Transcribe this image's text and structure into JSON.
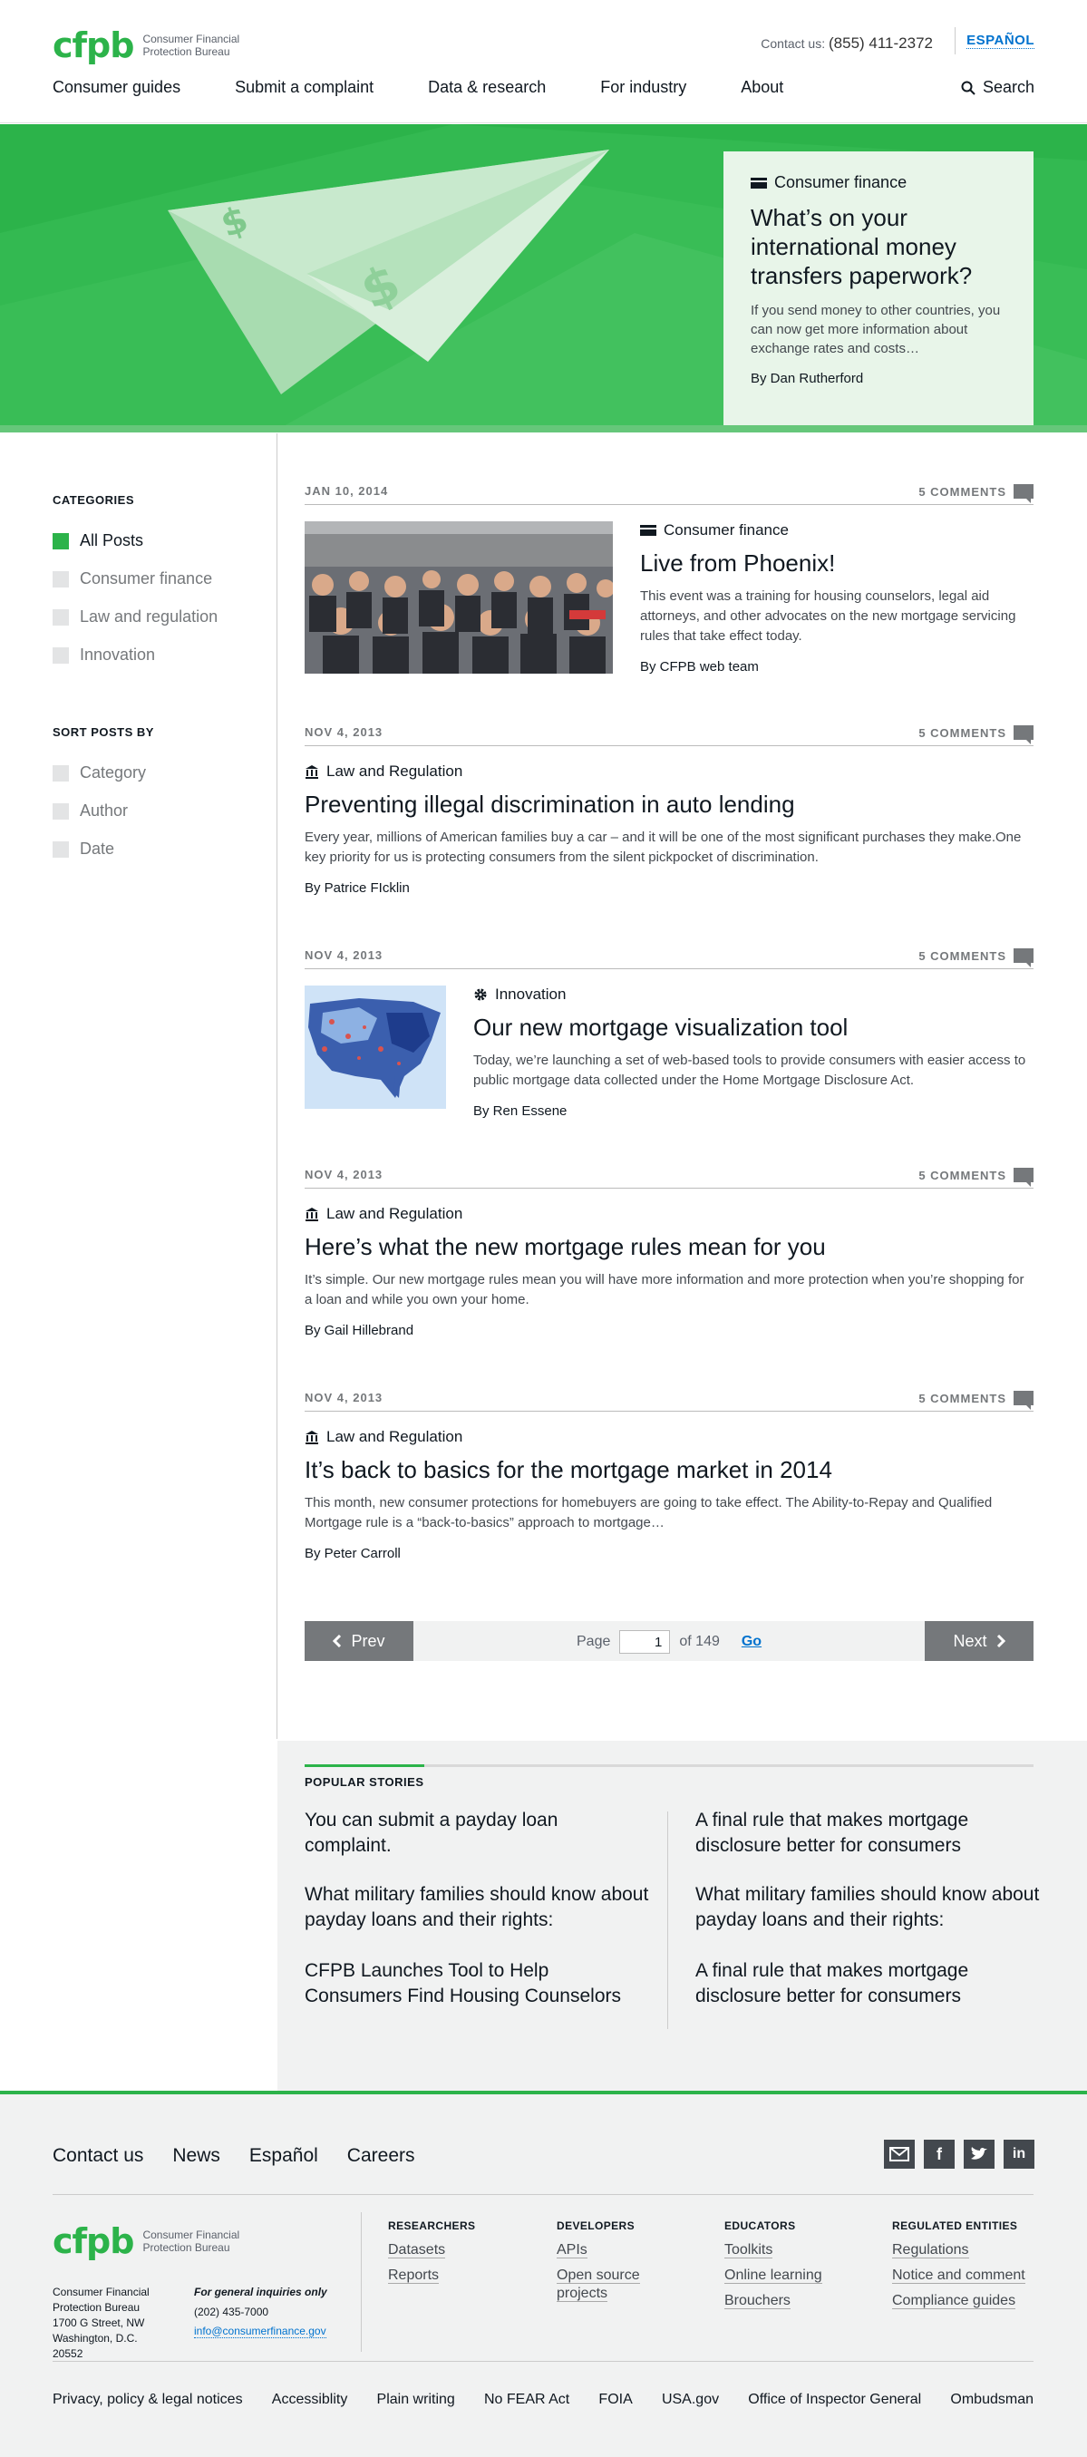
{
  "header": {
    "logo_mark": "cfpb",
    "logo_line1": "Consumer Financial",
    "logo_line2": "Protection Bureau",
    "contact_label": "Contact us:",
    "contact_phone": "(855) 411-2372",
    "language_link": "ESPAÑOL",
    "nav": [
      "Consumer guides",
      "Submit a complaint",
      "Data & research",
      "For industry",
      "About"
    ],
    "search_label": "Search"
  },
  "hero": {
    "category": "Consumer finance",
    "title": "What’s on your international money transfers paperwork?",
    "description": "If you send money to other countries, you can now get more information about exchange rates and costs…",
    "author": "By Dan Rutherford"
  },
  "sidebar": {
    "categories_heading": "CATEGORIES",
    "categories": [
      {
        "label": "All Posts",
        "checked": true
      },
      {
        "label": "Consumer finance",
        "checked": false
      },
      {
        "label": "Law and regulation",
        "checked": false
      },
      {
        "label": "Innovation",
        "checked": false
      }
    ],
    "sort_heading": "SORT POSTS BY",
    "sort": [
      {
        "label": "Category"
      },
      {
        "label": "Author"
      },
      {
        "label": "Date"
      }
    ]
  },
  "posts": [
    {
      "date": "JAN 10, 2014",
      "comments": "5 COMMENTS",
      "category": "Consumer finance",
      "category_icon": "card-icon",
      "title": "Live from Phoenix!",
      "description": "This event was a training for housing counselors, legal aid attorneys, and other advocates on the new mortgage servicing rules that take effect today.",
      "author": "By CFPB web team"
    },
    {
      "date": "NOV 4, 2013",
      "comments": "5 COMMENTS",
      "category": "Law and Regulation",
      "category_icon": "bank-icon",
      "title": "Preventing illegal discrimination in auto lending",
      "description": "Every year, millions of American families buy a car – and it will be one of the most significant purchases they make.One key priority for us is protecting consumers from the silent pickpocket of discrimination.",
      "author": "By Patrice FIcklin"
    },
    {
      "date": "NOV 4, 2013",
      "comments": "5 COMMENTS",
      "category": "Innovation",
      "category_icon": "gear-icon",
      "title": "Our new mortgage visualization tool",
      "description": "Today, we’re launching a set of web-based tools to provide consumers with easier access to public mortgage data collected under the Home Mortgage Disclosure Act.",
      "author": "By Ren Essene"
    },
    {
      "date": "NOV 4, 2013",
      "comments": "5 COMMENTS",
      "category": "Law and Regulation",
      "category_icon": "bank-icon",
      "title": "Here’s what the new mortgage rules mean for you",
      "description": "It’s simple. Our new mortgage rules mean you will have more information and more protection when you’re shopping for a loan and while you own your home.",
      "author": "By Gail Hillebrand"
    },
    {
      "date": "NOV 4, 2013",
      "comments": "5 COMMENTS",
      "category": "Law and Regulation",
      "category_icon": "bank-icon",
      "title": "It’s back to basics for the mortgage market in 2014",
      "description": "This month, new consumer protections for homebuyers are going to take effect. The Ability-to-Repay and Qualified Mortgage rule is a “back-to-basics” approach to mortgage…",
      "author": "By Peter Carroll"
    }
  ],
  "pagination": {
    "prev": "Prev",
    "next": "Next",
    "page_label": "Page",
    "page_value": "1",
    "of_label": "of 149",
    "go": "Go"
  },
  "popular": {
    "heading": "POPULAR STORIES",
    "left": [
      "You can submit a payday loan complaint.",
      "What military families should know about payday loans and their rights:",
      "CFPB Launches Tool to Help Consumers Find Housing Counselors"
    ],
    "right": [
      "A final rule that makes mortgage disclosure better for consumers",
      "What military families should know about payday loans and their rights:",
      "A final rule that makes mortgage disclosure better for consumers"
    ]
  },
  "footer": {
    "links": [
      "Contact us",
      "News",
      "Español",
      "Careers"
    ],
    "social": [
      "email-icon",
      "facebook-icon",
      "twitter-icon",
      "linkedin-icon"
    ],
    "address": [
      "Consumer Financial",
      "Protection Bureau",
      "1700 G Street, NW",
      "Washington, D.C. 20552"
    ],
    "inquiries_label": "For general inquiries only",
    "inquiries_phone": "(202) 435-7000",
    "inquiries_email": "info@consumerfinance.gov",
    "columns": [
      {
        "heading": "RESEARCHERS",
        "links": [
          "Datasets",
          "Reports"
        ]
      },
      {
        "heading": "DEVELOPERS",
        "links": [
          "APIs",
          "Open source projects"
        ]
      },
      {
        "heading": "EDUCATORS",
        "links": [
          "Toolkits",
          "Online learning",
          "Brouchers"
        ]
      },
      {
        "heading": "REGULATED ENTITIES",
        "links": [
          "Regulations",
          "Notice and comment",
          "Compliance guides"
        ]
      }
    ],
    "bottom_links": [
      "Privacy, policy & legal notices",
      "Accessiblity",
      "Plain writing",
      "No FEAR Act",
      "FOIA",
      "USA.gov",
      "Office of Inspector General",
      "Ombudsman"
    ]
  },
  "colors": {
    "brand_green": "#2cb34a",
    "link_blue": "#0072ce",
    "gray": "#75787b"
  }
}
